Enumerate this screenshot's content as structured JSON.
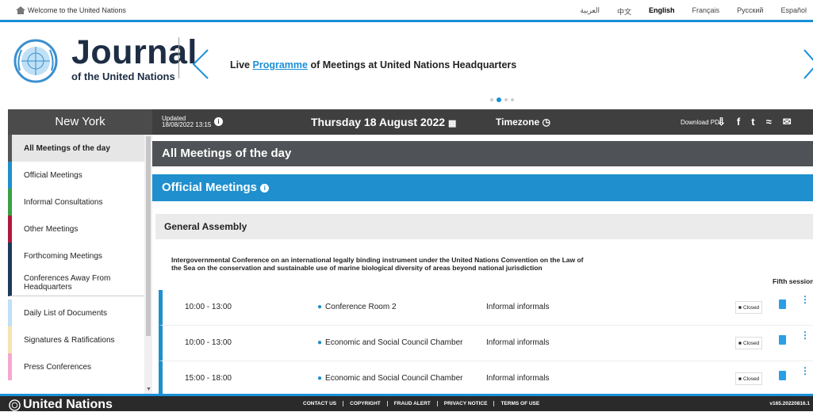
{
  "topbar": {
    "welcome": "Welcome to the United Nations",
    "languages": [
      {
        "label": "العربية",
        "active": false
      },
      {
        "label": "中文",
        "active": false
      },
      {
        "label": "English",
        "active": true
      },
      {
        "label": "Français",
        "active": false
      },
      {
        "label": "Русский",
        "active": false
      },
      {
        "label": "Español",
        "active": false
      }
    ]
  },
  "banner": {
    "title": "Journal",
    "subtitle": "of the United Nations",
    "live_prefix": "Live ",
    "live_link": "Programme",
    "live_suffix": " of Meetings at United Nations Headquarters"
  },
  "sidebar": {
    "location": "New York",
    "items": [
      {
        "label": "All Meetings of the day",
        "color": "#555555",
        "active": true
      },
      {
        "label": "Official Meetings",
        "color": "#1f8fce"
      },
      {
        "label": "Informal Consultations",
        "color": "#3aa043"
      },
      {
        "label": "Other Meetings",
        "color": "#b0183e"
      },
      {
        "label": "Forthcoming Meetings",
        "color": "#1d3a5a"
      },
      {
        "label": "Conferences Away From Headquarters",
        "color": "#1d3a5a"
      },
      {
        "label": "Daily List of Documents",
        "color": "#bfe0f5"
      },
      {
        "label": "Signatures & Ratifications",
        "color": "#f7e3b3"
      },
      {
        "label": "Press Conferences",
        "color": "#f3a8cf"
      }
    ]
  },
  "mainbar": {
    "updated_label": "Updated",
    "updated_time": "18/08/2022 13:15",
    "date": "Thursday 18 August 2022",
    "timezone": "Timezone",
    "download": "Download PDF"
  },
  "content": {
    "all_meetings": "All Meetings of the day",
    "official": "Official Meetings",
    "general_assembly": "General Assembly",
    "conference": "Intergovernmental Conference on an international legally binding instrument under the United Nations Convention on the Law of the Sea on the conservation and sustainable use of marine biological diversity of areas beyond national jurisdiction",
    "session": "Fifth session",
    "meetings": [
      {
        "time": "10:00 - 13:00",
        "room": "Conference Room 2",
        "type": "Informal informals",
        "status": "Closed"
      },
      {
        "time": "10:00 - 13:00",
        "room": "Economic and Social Council Chamber",
        "type": "Informal informals",
        "status": "Closed"
      },
      {
        "time": "15:00 - 18:00",
        "room": "Economic and Social Council Chamber",
        "type": "Informal informals",
        "status": "Closed"
      }
    ]
  },
  "footer": {
    "brand": "United Nations",
    "links": [
      "CONTACT US",
      "COPYRIGHT",
      "FRAUD ALERT",
      "PRIVACY NOTICE",
      "TERMS OF USE"
    ],
    "version": "v165.20220816.1"
  },
  "colors": {
    "accent": "#1a8fd8",
    "dark": "#3f3f3f",
    "navy": "#1d2d44"
  }
}
